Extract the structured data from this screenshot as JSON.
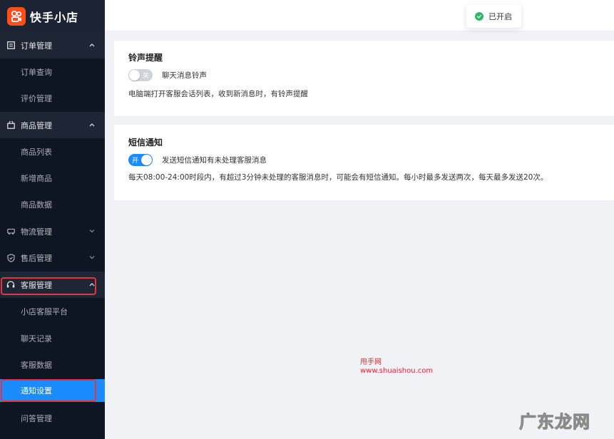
{
  "app": {
    "logo_text": "快手小店"
  },
  "sidebar": {
    "groups": [
      {
        "label": "订单管理",
        "items": [
          "订单查询",
          "评价管理"
        ]
      },
      {
        "label": "商品管理",
        "items": [
          "商品列表",
          "新增商品",
          "商品数据"
        ]
      },
      {
        "label": "物流管理"
      },
      {
        "label": "售后管理"
      },
      {
        "label": "客服管理",
        "items": [
          "小店客服平台",
          "聊天记录",
          "客服数据",
          "通知设置",
          "问答管理"
        ]
      }
    ],
    "active_item": "通知设置"
  },
  "toast": {
    "text": "已开启"
  },
  "ring_card": {
    "title": "铃声提醒",
    "toggle_text": "关",
    "toggle_state": "off",
    "option_label": "聊天消息铃声",
    "description": "电脑端打开客服会话列表，收到新消息时，有铃声提醒"
  },
  "sms_card": {
    "title": "短信通知",
    "toggle_text": "开",
    "toggle_state": "on",
    "option_label": "发送短信通知有未处理客服消息",
    "description": "每天08:00-24:00时段内，有超过3分钟未处理的客服消息时，可能会有短信通知。每小时最多发送两次，每天最多发送20次。"
  },
  "watermark": {
    "line1": "甩手网",
    "line2": "www.shuaishou.com",
    "corner": "广东龙网"
  },
  "colors": {
    "accent": "#1a8cff",
    "sidebar_bg": "#0f1623",
    "highlight": "#e8333f",
    "brand": "#ff4d1a",
    "success": "#2fb86b"
  }
}
